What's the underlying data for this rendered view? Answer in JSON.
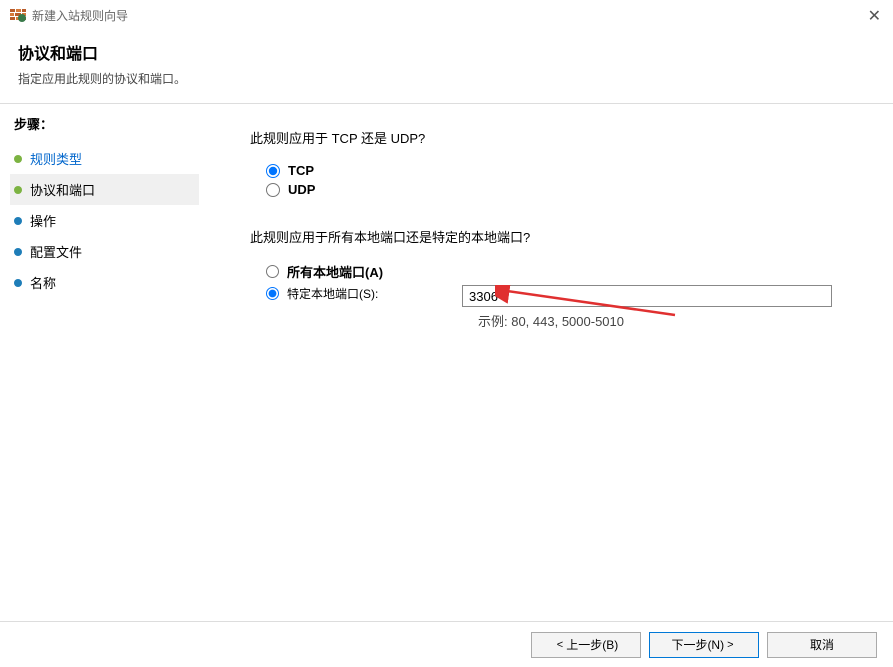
{
  "window": {
    "title": "新建入站规则向导"
  },
  "header": {
    "title": "协议和端口",
    "subtitle": "指定应用此规则的协议和端口。"
  },
  "sidebar": {
    "heading": "步骤：",
    "items": [
      {
        "label": "规则类型",
        "bullet": "green",
        "link": true,
        "selected": false
      },
      {
        "label": "协议和端口",
        "bullet": "green",
        "link": false,
        "selected": true
      },
      {
        "label": "操作",
        "bullet": "blue",
        "link": false,
        "selected": false
      },
      {
        "label": "配置文件",
        "bullet": "blue",
        "link": false,
        "selected": false
      },
      {
        "label": "名称",
        "bullet": "blue",
        "link": false,
        "selected": false
      }
    ]
  },
  "main": {
    "protocol_question": "此规则应用于 TCP 还是 UDP?",
    "tcp_label": "TCP",
    "udp_label": "UDP",
    "port_question": "此规则应用于所有本地端口还是特定的本地端口?",
    "all_ports_label": "所有本地端口(A)",
    "specific_ports_label": "特定本地端口(S):",
    "port_value": "3306",
    "port_example": "示例: 80, 443, 5000-5010"
  },
  "footer": {
    "back": "上一步(B)",
    "next": "下一步(N)",
    "cancel": "取消"
  }
}
